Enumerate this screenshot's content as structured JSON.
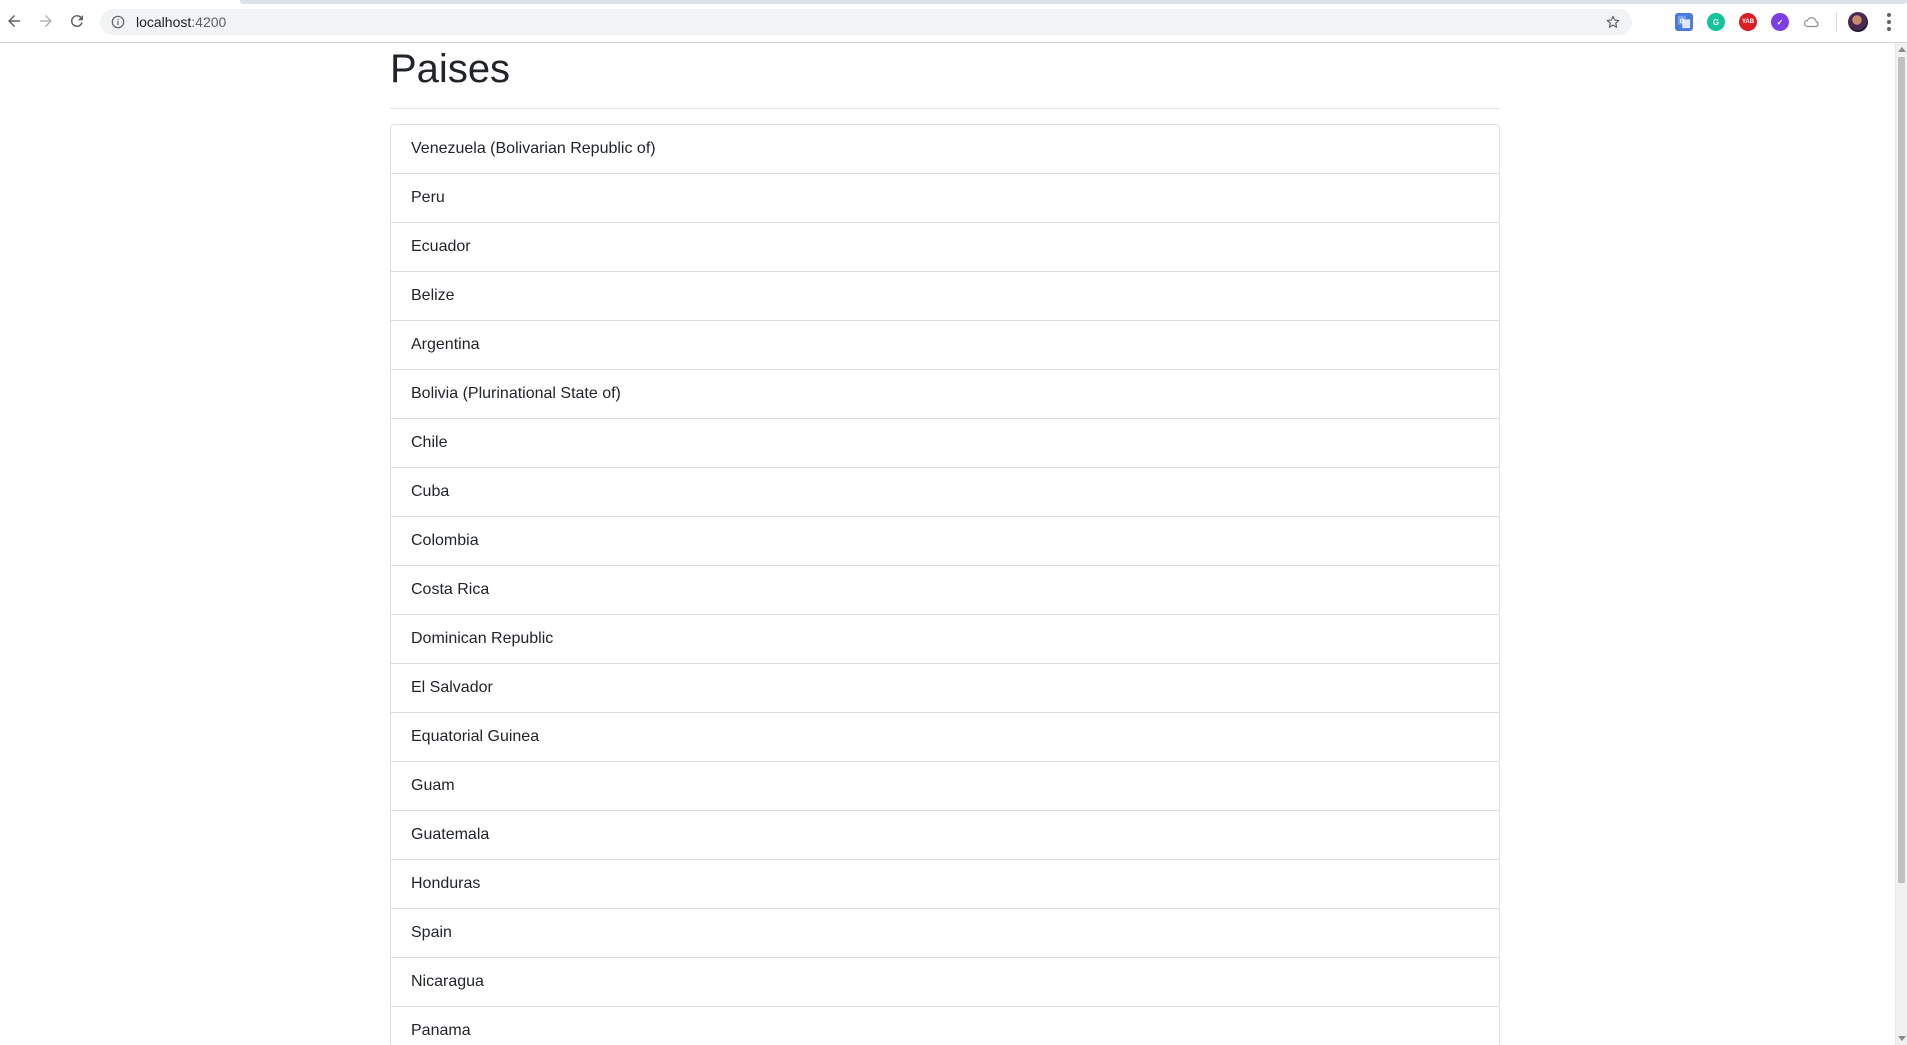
{
  "browser": {
    "url_host": "localhost",
    "url_port": ":4200",
    "extensions": [
      {
        "name": "google-translate-icon",
        "color": "#4a7bd8",
        "text": ""
      },
      {
        "name": "grammarly-icon",
        "color": "#15c39a",
        "text": "G"
      },
      {
        "name": "yabla-icon",
        "color": "#d81f26",
        "text": "YAB"
      },
      {
        "name": "checkmark-extension-icon",
        "color": "#7b3fe4",
        "text": "✓"
      },
      {
        "name": "cloud-extension-icon",
        "color": "#ffffff",
        "text": ""
      }
    ]
  },
  "page": {
    "title": "Paises",
    "countries": [
      "Venezuela (Bolivarian Republic of)",
      "Peru",
      "Ecuador",
      "Belize",
      "Argentina",
      "Bolivia (Plurinational State of)",
      "Chile",
      "Cuba",
      "Colombia",
      "Costa Rica",
      "Dominican Republic",
      "El Salvador",
      "Equatorial Guinea",
      "Guam",
      "Guatemala",
      "Honduras",
      "Spain",
      "Nicaragua",
      "Panama"
    ]
  }
}
